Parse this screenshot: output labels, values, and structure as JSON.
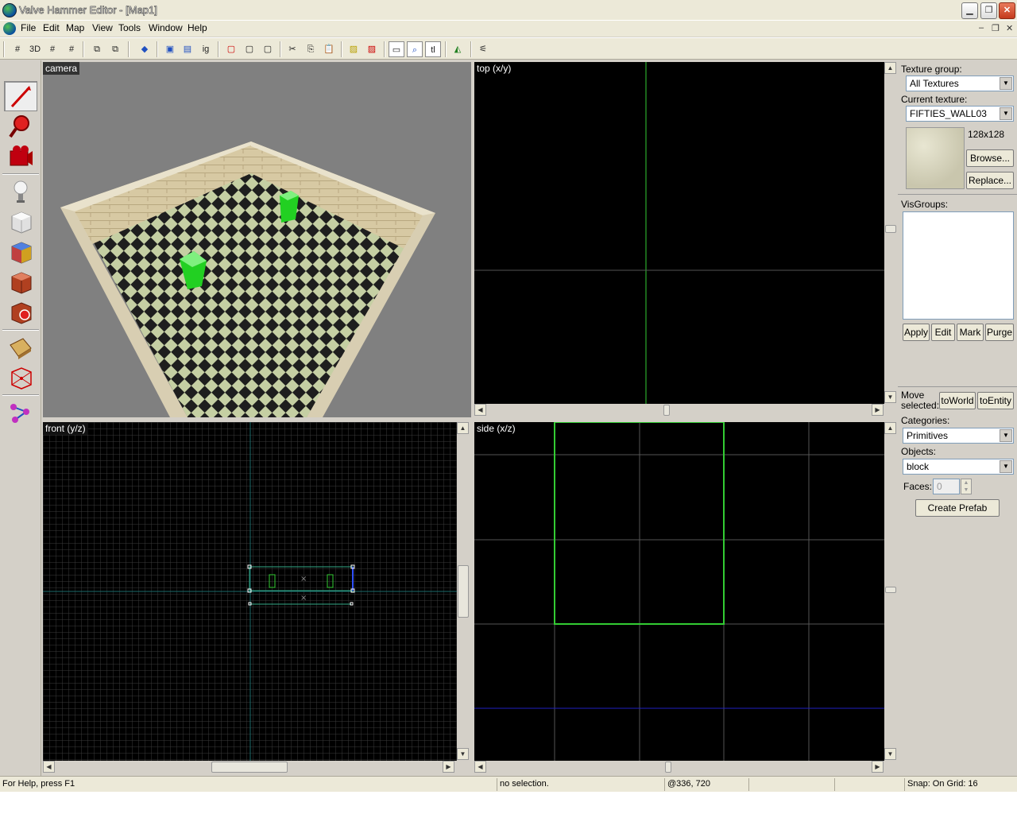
{
  "window": {
    "title": "Valve Hammer Editor - [Map1]",
    "min_glyph": "▁",
    "restore_glyph": "❐",
    "close_glyph": "✕"
  },
  "menubar": {
    "items": [
      "File",
      "Edit",
      "Map",
      "View",
      "Tools",
      "Window",
      "Help"
    ],
    "mdi_min": "–",
    "mdi_restore": "❐",
    "mdi_close": "✕"
  },
  "toolbar": {
    "tools": [
      {
        "icon": "grid-icon",
        "glyph": "#"
      },
      {
        "icon": "3d-grid-icon",
        "glyph": "3D"
      },
      {
        "icon": "grid-dots-icon",
        "glyph": "#"
      },
      {
        "icon": "grid-plus-icon",
        "glyph": "#"
      },
      {
        "icon": "group-icon",
        "glyph": "⧉"
      },
      {
        "icon": "ungroup-icon",
        "glyph": "⧉"
      },
      {
        "icon": "hide-icon",
        "glyph": "◆"
      },
      {
        "icon": "select-entity-icon",
        "glyph": "▣"
      },
      {
        "icon": "select-group-icon",
        "glyph": "▤"
      },
      {
        "icon": "ignore-groups-icon",
        "glyph": "ig"
      },
      {
        "icon": "carve-icon",
        "glyph": "▢"
      },
      {
        "icon": "hollow-icon",
        "glyph": "▢"
      },
      {
        "icon": "cube-icon",
        "glyph": "▢"
      },
      {
        "icon": "cut-icon",
        "glyph": "✂"
      },
      {
        "icon": "copy-icon",
        "glyph": "⎘"
      },
      {
        "icon": "paste-icon",
        "glyph": "📋"
      },
      {
        "icon": "texture-lock-icon",
        "glyph": "▨"
      },
      {
        "icon": "texture-scale-lock-icon",
        "glyph": "▨"
      },
      {
        "icon": "select-box-icon",
        "glyph": "▭"
      },
      {
        "icon": "magnify-icon",
        "glyph": "⌕"
      },
      {
        "icon": "tl-icon",
        "glyph": "tl"
      },
      {
        "icon": "run-map-icon",
        "glyph": "◭"
      },
      {
        "icon": "compile-icon",
        "glyph": "⚟"
      }
    ]
  },
  "palette": {
    "tools": [
      "selection-tool-icon",
      "magnify-tool-icon",
      "camera-tool-icon",
      "entity-tool-icon",
      "block-tool-icon",
      "texture-application-icon",
      "apply-texture-icon",
      "decal-tool-icon",
      "overlay-tool-icon",
      "clipping-tool-icon",
      "vertex-tool-icon",
      "path-tool-icon"
    ]
  },
  "viewports": {
    "camera": "camera",
    "top": "top (x/y)",
    "front": "front (y/z)",
    "side": "side (x/z)"
  },
  "right_panel": {
    "texture_group_label": "Texture group:",
    "texture_group_value": "All Textures",
    "current_texture_label": "Current texture:",
    "current_texture_value": "FIFTIES_WALL03",
    "texture_size": "128x128",
    "browse": "Browse...",
    "replace": "Replace...",
    "visgroups_label": "VisGroups:",
    "apply": "Apply",
    "edit": "Edit",
    "mark": "Mark",
    "purge": "Purge",
    "move_selected": "Move selected:",
    "to_world": "toWorld",
    "to_entity": "toEntity",
    "categories_label": "Categories:",
    "categories_value": "Primitives",
    "objects_label": "Objects:",
    "objects_value": "block",
    "faces_label": "Faces:",
    "faces_value": "0",
    "create_prefab": "Create Prefab"
  },
  "statusbar": {
    "help": "For Help, press F1",
    "selection": "no selection.",
    "coords": "@336, 720",
    "snap": "Snap: On Grid: 16"
  },
  "colors": {
    "viewport_bg": "#000000",
    "grid_line": "#4d4d4d",
    "brush_green": "#33cc33",
    "axis_blue": "#2020c0",
    "camera_bg": "#808080"
  }
}
